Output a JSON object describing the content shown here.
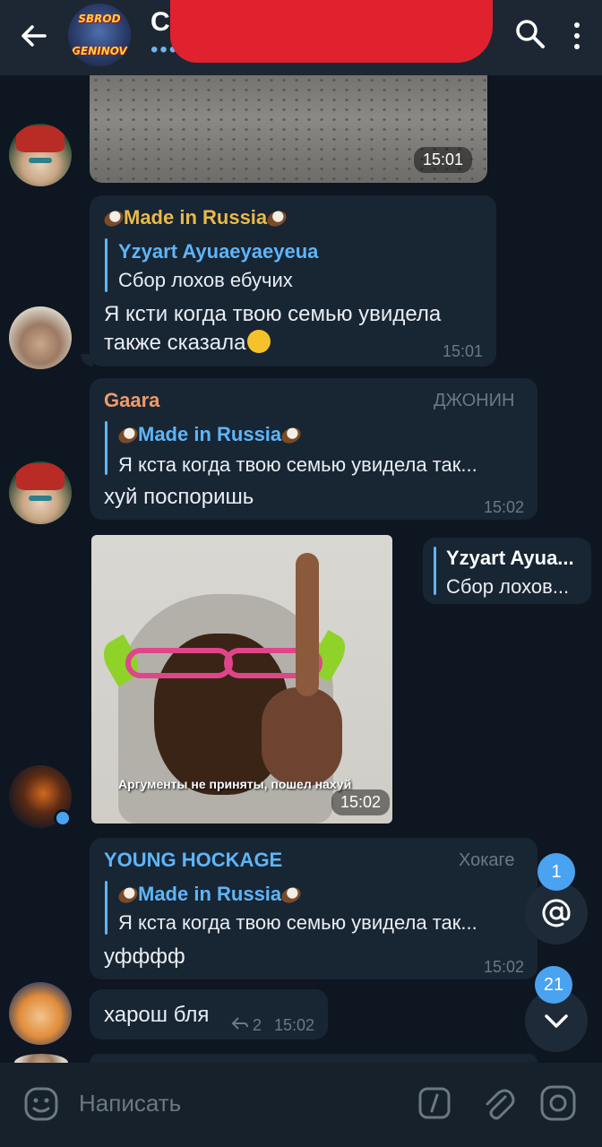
{
  "header": {
    "avatar_line1": "SBROD",
    "avatar_line2": "GENINOV",
    "title": "Сб",
    "subtitle": "•••"
  },
  "messages": [
    {
      "type": "photo",
      "time": "15:01"
    },
    {
      "author": "Made in Russia",
      "reply_author": "Yzyart Ayuaeyaeyeua",
      "reply_text": "Сбор лохов ебучих",
      "text_line1": "Я ксти когда твою семью увидела",
      "text_line2": "также сказала",
      "time": "15:01"
    },
    {
      "author": "Gaara",
      "role": "ДЖОНИН",
      "reply_author": "Made in Russia",
      "reply_text": "Я кста когда твою семью увидела так...",
      "text": "хуй поспоришь",
      "time": "15:02"
    },
    {
      "type": "meme",
      "caption": "Аргументы не приняты, пошел нахуй",
      "time": "15:02",
      "reply_author": "Yzyart Ayua...",
      "reply_text": "Сбор лохов..."
    },
    {
      "author": "YOUNG HOCKAGE",
      "role": "Хокаге",
      "reply_author": "Made in Russia",
      "reply_text": "Я кста когда твою семью увидела так...",
      "text": "уфффф",
      "time": "15:02"
    },
    {
      "text": "харош бля",
      "replies_count": "2",
      "time": "15:02"
    }
  ],
  "floating": {
    "mentions_count": "1",
    "unread_count": "21"
  },
  "composer": {
    "placeholder": "Написать"
  },
  "colors": {
    "background": "#0e1621",
    "bubble": "#182533",
    "accent": "#5eb5f7",
    "author_made_in_russia": "#e9b94a",
    "author_gaara": "#f09a6b"
  }
}
